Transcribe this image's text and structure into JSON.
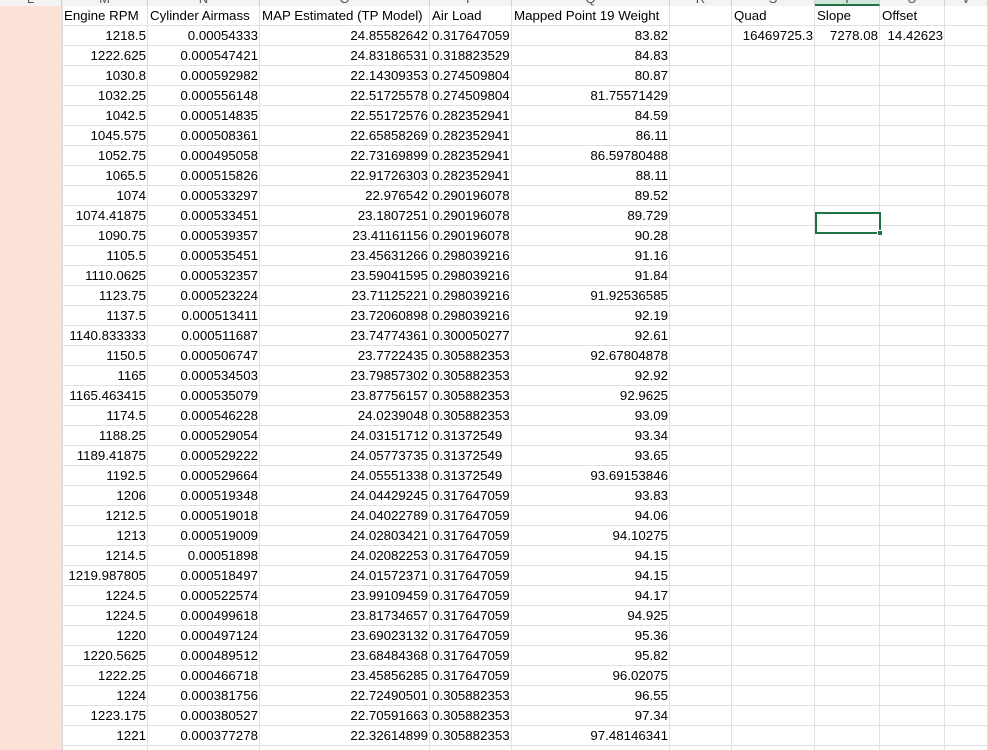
{
  "column_letters": [
    {
      "key": "L",
      "label": "L"
    },
    {
      "key": "M",
      "label": "M"
    },
    {
      "key": "N",
      "label": "N"
    },
    {
      "key": "O",
      "label": "O"
    },
    {
      "key": "P",
      "label": "P"
    },
    {
      "key": "Q",
      "label": "Q"
    },
    {
      "key": "R",
      "label": "R"
    },
    {
      "key": "S",
      "label": "S"
    },
    {
      "key": "T",
      "label": "T"
    },
    {
      "key": "U",
      "label": "U"
    },
    {
      "key": "V",
      "label": "V"
    }
  ],
  "selected_column": "T",
  "headers": {
    "M": "Engine RPM",
    "N": "Cylinder Airmass",
    "O": "MAP Estimated (TP Model)",
    "P": "Air Load",
    "Q": "Mapped Point 19 Weight",
    "S": "Quad",
    "T": "Slope",
    "U": "Offset"
  },
  "coefficients": {
    "S": "16469725.3",
    "T": "7278.08",
    "U": "14.42623"
  },
  "rows": [
    [
      "1218.5",
      "0.00054333",
      "24.85582642",
      "0.317647059",
      "83.82"
    ],
    [
      "1222.625",
      "0.000547421",
      "24.83186531",
      "0.318823529",
      "84.83"
    ],
    [
      "1030.8",
      "0.000592982",
      "22.14309353",
      "0.274509804",
      "80.87"
    ],
    [
      "1032.25",
      "0.000556148",
      "22.51725578",
      "0.274509804",
      "81.75571429"
    ],
    [
      "1042.5",
      "0.000514835",
      "22.55172576",
      "0.282352941",
      "84.59"
    ],
    [
      "1045.575",
      "0.000508361",
      "22.65858269",
      "0.282352941",
      "86.11"
    ],
    [
      "1052.75",
      "0.000495058",
      "22.73169899",
      "0.282352941",
      "86.59780488"
    ],
    [
      "1065.5",
      "0.000515826",
      "22.91726303",
      "0.282352941",
      "88.11"
    ],
    [
      "1074",
      "0.000533297",
      "22.976542",
      "0.290196078",
      "89.52"
    ],
    [
      "1074.41875",
      "0.000533451",
      "23.1807251",
      "0.290196078",
      "89.729"
    ],
    [
      "1090.75",
      "0.000539357",
      "23.41161156",
      "0.290196078",
      "90.28"
    ],
    [
      "1105.5",
      "0.000535451",
      "23.45631266",
      "0.298039216",
      "91.16"
    ],
    [
      "1110.0625",
      "0.000532357",
      "23.59041595",
      "0.298039216",
      "91.84"
    ],
    [
      "1123.75",
      "0.000523224",
      "23.71125221",
      "0.298039216",
      "91.92536585"
    ],
    [
      "1137.5",
      "0.000513411",
      "23.72060898",
      "0.298039216",
      "92.19"
    ],
    [
      "1140.833333",
      "0.000511687",
      "23.74774361",
      "0.300050277",
      "92.61"
    ],
    [
      "1150.5",
      "0.000506747",
      "23.7722435",
      "0.305882353",
      "92.67804878"
    ],
    [
      "1165",
      "0.000534503",
      "23.79857302",
      "0.305882353",
      "92.92"
    ],
    [
      "1165.463415",
      "0.000535079",
      "23.87756157",
      "0.305882353",
      "92.9625"
    ],
    [
      "1174.5",
      "0.000546228",
      "24.0239048",
      "0.305882353",
      "93.09"
    ],
    [
      "1188.25",
      "0.000529054",
      "24.03151712",
      "0.31372549",
      "93.34"
    ],
    [
      "1189.41875",
      "0.000529222",
      "24.05773735",
      "0.31372549",
      "93.65"
    ],
    [
      "1192.5",
      "0.000529664",
      "24.05551338",
      "0.31372549",
      "93.69153846"
    ],
    [
      "1206",
      "0.000519348",
      "24.04429245",
      "0.317647059",
      "93.83"
    ],
    [
      "1212.5",
      "0.000519018",
      "24.04022789",
      "0.317647059",
      "94.06"
    ],
    [
      "1213",
      "0.000519009",
      "24.02803421",
      "0.317647059",
      "94.10275"
    ],
    [
      "1214.5",
      "0.00051898",
      "24.02082253",
      "0.317647059",
      "94.15"
    ],
    [
      "1219.987805",
      "0.000518497",
      "24.01572371",
      "0.317647059",
      "94.15"
    ],
    [
      "1224.5",
      "0.000522574",
      "23.99109459",
      "0.317647059",
      "94.17"
    ],
    [
      "1224.5",
      "0.000499618",
      "23.81734657",
      "0.317647059",
      "94.925"
    ],
    [
      "1220",
      "0.000497124",
      "23.69023132",
      "0.317647059",
      "95.36"
    ],
    [
      "1220.5625",
      "0.000489512",
      "23.68484368",
      "0.317647059",
      "95.82"
    ],
    [
      "1222.25",
      "0.000466718",
      "23.45856285",
      "0.317647059",
      "96.02075"
    ],
    [
      "1224",
      "0.000381756",
      "22.72490501",
      "0.305882353",
      "96.55"
    ],
    [
      "1223.175",
      "0.000380527",
      "22.70591663",
      "0.305882353",
      "97.34"
    ],
    [
      "1221",
      "0.000377278",
      "22.32614899",
      "0.305882353",
      "97.48146341"
    ]
  ],
  "colors": {
    "grid_line": "#e1e1e1",
    "left_column_fill": "#fce2d6",
    "selection": "#217346",
    "header_bg": "#f3f3f3"
  }
}
